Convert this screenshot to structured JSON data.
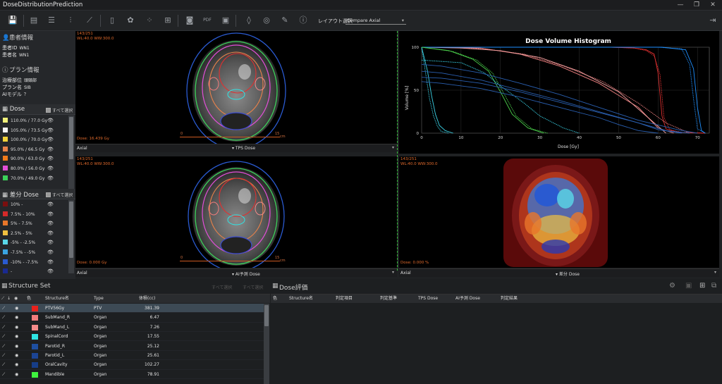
{
  "app": {
    "title": "DoseDistributionPrediction"
  },
  "window": {
    "min": "—",
    "restore": "❐",
    "close": "✕"
  },
  "toolbar": {
    "layout_label": "レイアウト選択",
    "layout_value": "Compare Axial"
  },
  "patient": {
    "section_title": "患者情報",
    "id_label": "患者ID",
    "id_value": "WN1",
    "name_label": "患者名",
    "name_value": "WN1"
  },
  "plan": {
    "section_title": "プラン情報",
    "site_label": "治療部位",
    "site_value": "頭頸部",
    "plan_label": "プラン名",
    "plan_value": "SIB",
    "ai_label": "AIモデル",
    "ai_value": "？"
  },
  "dose": {
    "title": "Dose",
    "select_all": "すべて選択",
    "levels": [
      {
        "label": "110.0% / 77.0 Gy",
        "color": "#f0f07a"
      },
      {
        "label": "105.0% / 73.5 Gy",
        "color": "#f4f4f4"
      },
      {
        "label": "100.0% / 70.0 Gy",
        "color": "#f2d23a"
      },
      {
        "label": "95.0% / 66.5 Gy",
        "color": "#e8824a"
      },
      {
        "label": "90.0% / 63.0 Gy",
        "color": "#f07a1a"
      },
      {
        "label": "80.0% / 56.0 Gy",
        "color": "#e24fd8"
      },
      {
        "label": "70.0% / 49.0 Gy",
        "color": "#3cd25a"
      }
    ]
  },
  "diff": {
    "title": "差分 Dose",
    "select_all": "すべて選択",
    "levels": [
      {
        "label": "10% -",
        "color": "#7a0f0f"
      },
      {
        "label": "7.5% - 10%",
        "color": "#d42a2a"
      },
      {
        "label": "5% - 7.5%",
        "color": "#e8762a"
      },
      {
        "label": "2.5% - 5%",
        "color": "#f0c040"
      },
      {
        "label": "-5% - -2.5%",
        "color": "#5ad8e8"
      },
      {
        "label": "-7.5% - -5%",
        "color": "#3aa4e0"
      },
      {
        "label": "-10% - -7.5%",
        "color": "#2a5ad0"
      },
      {
        "label": "-",
        "color": "#1a2a90"
      }
    ]
  },
  "views": {
    "tl": {
      "info1": "143/251",
      "info2": "WL:40.0 WW:300.0",
      "dose": "Dose: 16.439 Gy",
      "plane": "Axial",
      "source": "TPS Dose",
      "scale0": "0",
      "scale15": "15",
      "unit": "cm"
    },
    "bl": {
      "info1": "143/251",
      "info2": "WL:40.0 WW:300.0",
      "dose": "Dose: 0.000 Gy",
      "plane": "Axial",
      "source": "AI予測 Dose",
      "scale0": "0",
      "scale15": "15",
      "unit": "cm"
    },
    "br": {
      "info1": "143/251",
      "info2": "WL:40.0 WW:300.0",
      "dose": "Dose: 0.000 %",
      "plane": "Axial",
      "source": "差分 Dose"
    }
  },
  "chart_data": {
    "type": "line",
    "title": "Dose Volume Histogram",
    "xlabel": "Dose [Gy]",
    "ylabel": "Volume [%]",
    "xlim": [
      0,
      73
    ],
    "ylim": [
      0,
      100
    ],
    "xticks": [
      0,
      10,
      20,
      30,
      40,
      50,
      60,
      70
    ],
    "yticks": [
      0,
      50,
      100
    ],
    "grid": true,
    "series": [
      {
        "color": "#e03030",
        "x": [
          0,
          48,
          54,
          57,
          59,
          60,
          61,
          62,
          65,
          72
        ],
        "y": [
          100,
          100,
          99,
          97,
          92,
          70,
          20,
          5,
          1,
          0
        ]
      },
      {
        "color": "#e03030",
        "x": [
          0,
          48,
          54,
          57,
          59,
          60.5,
          61.5,
          63,
          66,
          72
        ],
        "y": [
          100,
          100,
          99,
          96,
          90,
          68,
          18,
          4,
          1,
          0
        ]
      },
      {
        "color": "#f08080",
        "x": [
          0,
          5,
          15,
          25,
          35,
          45,
          55,
          60,
          64
        ],
        "y": [
          100,
          100,
          99,
          92,
          78,
          58,
          30,
          6,
          0
        ]
      },
      {
        "color": "#f08080",
        "x": [
          0,
          6,
          16,
          26,
          36,
          46,
          55,
          62,
          68
        ],
        "y": [
          100,
          100,
          98,
          92,
          78,
          60,
          35,
          12,
          0
        ]
      },
      {
        "color": "#f4a0a0",
        "x": [
          0,
          10,
          20,
          30,
          40,
          50,
          57,
          62
        ],
        "y": [
          100,
          99,
          96,
          88,
          72,
          48,
          20,
          0
        ]
      },
      {
        "color": "#1e90ff",
        "x": [
          0,
          60,
          66,
          68,
          69,
          70,
          72
        ],
        "y": [
          100,
          100,
          98,
          80,
          40,
          5,
          0
        ]
      },
      {
        "color": "#1e90ff",
        "x": [
          0,
          61,
          67,
          69,
          70,
          71,
          72
        ],
        "y": [
          100,
          100,
          97,
          75,
          30,
          3,
          0
        ]
      },
      {
        "color": "#4bd04b",
        "x": [
          0,
          8,
          14,
          18,
          21,
          24,
          28,
          32
        ],
        "y": [
          100,
          95,
          85,
          70,
          45,
          20,
          5,
          0
        ]
      },
      {
        "color": "#4bd04b",
        "x": [
          0,
          7,
          13,
          17,
          20,
          23,
          27,
          31
        ],
        "y": [
          100,
          96,
          86,
          72,
          48,
          22,
          6,
          0
        ]
      },
      {
        "color": "#3ad4e8",
        "x": [
          0,
          1,
          2,
          3,
          4,
          5,
          7
        ],
        "y": [
          100,
          70,
          40,
          20,
          8,
          2,
          0
        ]
      },
      {
        "color": "#3ad4e8",
        "x": [
          0,
          1.5,
          2.5,
          3.5,
          4.5,
          6,
          8
        ],
        "y": [
          100,
          72,
          44,
          22,
          9,
          3,
          0
        ]
      },
      {
        "color": "#3ad4e8",
        "x": [
          0,
          10,
          16,
          20,
          26,
          30,
          36,
          40
        ],
        "y": [
          85,
          82,
          70,
          55,
          35,
          20,
          6,
          0
        ]
      },
      {
        "color": "#2a5fb0",
        "x": [
          0,
          5,
          15,
          25,
          35,
          45,
          55,
          65,
          70
        ],
        "y": [
          80,
          78,
          70,
          58,
          45,
          30,
          15,
          4,
          0
        ]
      },
      {
        "color": "#2a5fb0",
        "x": [
          0,
          5,
          15,
          25,
          35,
          45,
          55,
          62,
          68
        ],
        "y": [
          72,
          70,
          62,
          50,
          38,
          25,
          12,
          3,
          0
        ]
      },
      {
        "color": "#2a5fb0",
        "x": [
          0,
          5,
          15,
          25,
          35,
          45,
          55,
          60,
          66
        ],
        "y": [
          65,
          64,
          58,
          48,
          36,
          24,
          12,
          4,
          0
        ]
      },
      {
        "color": "#2a5fb0",
        "x": [
          0,
          5,
          15,
          25,
          35,
          45,
          50,
          55,
          60
        ],
        "y": [
          60,
          58,
          52,
          42,
          30,
          18,
          10,
          3,
          0
        ]
      }
    ]
  },
  "structure_panel": {
    "title": "Structure Set",
    "btn_deselect": "すべて選択",
    "btn_select": "すべて選択",
    "headers": {
      "color": "色",
      "name": "Structure名",
      "type": "Type",
      "volume": "体積(cc)"
    },
    "rows": [
      {
        "name": "PTV56Gy",
        "type": "PTV",
        "volume": "381.39",
        "color": "#e8211c"
      },
      {
        "name": "SubMand_R",
        "type": "Organ",
        "volume": "6.47",
        "color": "#f27c7c"
      },
      {
        "name": "SubMand_L",
        "type": "Organ",
        "volume": "7.26",
        "color": "#f58a8a"
      },
      {
        "name": "SpinalCord",
        "type": "Organ",
        "volume": "17.55",
        "color": "#2fe4e4"
      },
      {
        "name": "Parotid_R",
        "type": "Organ",
        "volume": "25.12",
        "color": "#1e4fa0"
      },
      {
        "name": "Parotid_L",
        "type": "Organ",
        "volume": "25.61",
        "color": "#1c4494"
      },
      {
        "name": "OralCavity",
        "type": "Organ",
        "volume": "102.27",
        "color": "#163d88"
      },
      {
        "name": "Mandible",
        "type": "Organ",
        "volume": "78.91",
        "color": "#3ef23e"
      }
    ]
  },
  "eval_panel": {
    "title": "Dose評価",
    "headers": {
      "color": "色",
      "name": "Structure名",
      "item": "判定項目",
      "criteria": "判定基準",
      "tps": "TPS Dose",
      "ai": "AI予測 Dose",
      "result": "判定結果"
    }
  }
}
